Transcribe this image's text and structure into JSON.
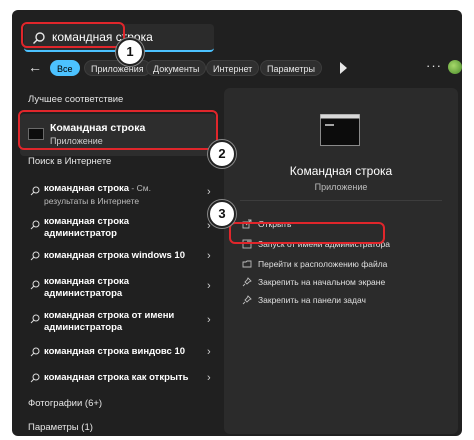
{
  "search": {
    "query": "командная строка"
  },
  "badges": [
    "1",
    "2",
    "3"
  ],
  "filters": {
    "back_icon": "back-arrow-icon",
    "items": [
      "Все",
      "Приложения",
      "Документы",
      "Интернет",
      "Параметры"
    ],
    "active": "Все",
    "more_icon": "more-icon",
    "play_icon": "play-icon"
  },
  "best_match": {
    "heading": "Лучшее соответствие",
    "title": "Командная строка",
    "subtitle": "Приложение"
  },
  "web": {
    "heading": "Поиск в Интернете",
    "items": [
      {
        "bold": "командная строка",
        "rest": " - См. результаты в Интернете"
      },
      {
        "bold": "командная строка администратор",
        "rest": ""
      },
      {
        "bold": "командная строка windows 10",
        "rest": ""
      },
      {
        "bold": "командная строка администратора",
        "rest": ""
      },
      {
        "bold": "командная строка от имени администратора",
        "rest": ""
      },
      {
        "bold": "командная строка виндовс 10",
        "rest": ""
      },
      {
        "bold": "командная строка как открыть",
        "rest": ""
      }
    ]
  },
  "footer": {
    "photos": "Фотографии (6+)",
    "settings": "Параметры (1)"
  },
  "preview": {
    "title": "Командная строка",
    "subtitle": "Приложение",
    "actions": [
      {
        "label": "Открыть",
        "icon": "open-icon"
      },
      {
        "label": "Запуск от имени администратора",
        "icon": "shield-icon"
      },
      {
        "label": "Перейти к расположению файла",
        "icon": "folder-icon"
      },
      {
        "label": "Закрепить на начальном экране",
        "icon": "pin-icon"
      },
      {
        "label": "Закрепить на панели задач",
        "icon": "pin-icon"
      }
    ]
  },
  "colors": {
    "accent": "#4cc2ff",
    "highlight": "#e0262b",
    "panel": "#202020"
  }
}
